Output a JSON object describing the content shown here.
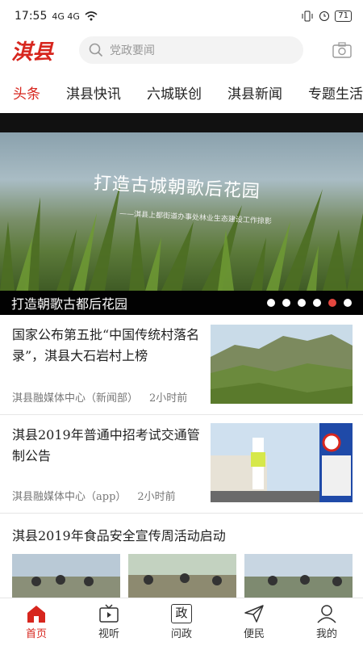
{
  "status": {
    "time": "17:55",
    "signal": "4G 4G",
    "battery": "71"
  },
  "header": {
    "logo": "淇县",
    "search_placeholder": "党政要闻"
  },
  "tabs": [
    {
      "label": "头条",
      "active": true
    },
    {
      "label": "淇县快讯"
    },
    {
      "label": "六城联创"
    },
    {
      "label": "淇县新闻"
    },
    {
      "label": "专题生活"
    }
  ],
  "banner": {
    "image_title": "打造古城朝歌后花园",
    "image_subtitle": "——淇县上都街道办事处林业生态建设工作掠影",
    "caption": "打造朝歌古都后花园",
    "slides": 6,
    "active_slide": 5
  },
  "news": [
    {
      "title": "国家公布第五批“中国传统村落名录”，淇县大石岩村上榜",
      "source": "淇县融媒体中心（新闻部）",
      "time": "2小时前"
    },
    {
      "title": " 淇县2019年普通中招考试交通管制公告",
      "source": "淇县融媒体中心（app）",
      "time": "2小时前"
    }
  ],
  "gallery": {
    "title": "淇县2019年食品安全宣传周活动启动"
  },
  "bottom_nav": [
    {
      "label": "首页",
      "icon": "home-icon",
      "active": true
    },
    {
      "label": "视听",
      "icon": "tv-icon"
    },
    {
      "label": "问政",
      "icon": "zheng-icon",
      "glyph": "政"
    },
    {
      "label": "便民",
      "icon": "send-icon"
    },
    {
      "label": "我的",
      "icon": "user-icon"
    }
  ],
  "colors": {
    "accent": "#d7261e"
  }
}
